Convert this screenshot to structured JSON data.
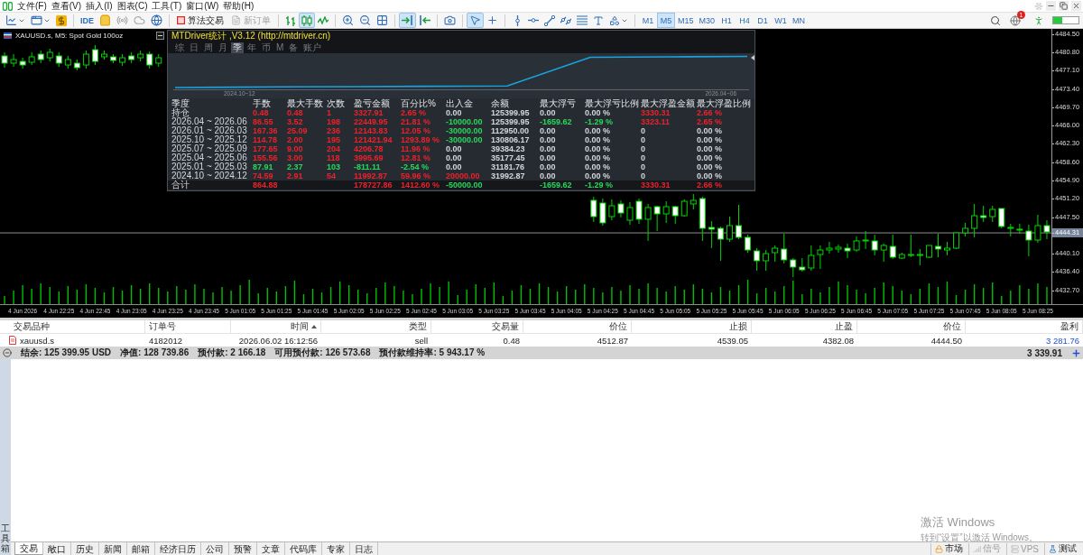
{
  "menu_bar": {
    "items": [
      "文件(F)",
      "查看(V)",
      "插入(I)",
      "图表(C)",
      "工具(T)",
      "窗口(W)",
      "帮助(H)"
    ]
  },
  "toolbar": {
    "ide_label": "IDE",
    "algo_trading": {
      "label": "算法交易",
      "on": false
    },
    "new_order": {
      "label": "新订单",
      "disabled": true
    },
    "chart_modes": [
      {
        "selected": false
      },
      {
        "selected": true
      },
      {
        "selected": false
      }
    ],
    "auto_scroll": {
      "on": true
    },
    "chart_shift": {
      "on": false
    },
    "cursor_modes": [
      {
        "selected": true
      },
      {
        "selected": false
      }
    ],
    "timeframes": [
      {
        "label": "M1",
        "selected": false
      },
      {
        "label": "M5",
        "selected": true
      },
      {
        "label": "M15",
        "selected": false
      },
      {
        "label": "M30",
        "selected": false
      },
      {
        "label": "H1",
        "selected": false
      },
      {
        "label": "H4",
        "selected": false
      },
      {
        "label": "D1",
        "selected": false
      },
      {
        "label": "W1",
        "selected": false
      },
      {
        "label": "MN",
        "selected": false
      }
    ],
    "notification_badge": "1"
  },
  "chart": {
    "title": "XAUUSD.s, M5: Spot Gold 100oz",
    "chart_data": {
      "type": "candlestick",
      "categories": [
        null,
        null,
        "4 Jun 2026",
        null,
        null,
        null,
        "4 Jun 22:25",
        null,
        null,
        null,
        "4 Jun 22:45",
        null,
        null,
        null,
        "4 Jun 23:05",
        null,
        null,
        null,
        "4 Jun 23:25",
        null,
        null,
        null,
        "4 Jun 23:45",
        null,
        null,
        null,
        "5 Jun 01:05",
        null,
        null,
        null,
        "5 Jun 01:25",
        null,
        null,
        null,
        "5 Jun 01:45",
        null,
        null,
        null,
        "5 Jun 02:05",
        null,
        null,
        null,
        "5 Jun 02:25",
        null,
        null,
        null,
        "5 Jun 02:45",
        null,
        null,
        null,
        "5 Jun 03:05",
        null,
        null,
        null,
        "5 Jun 03:25",
        null,
        null,
        null,
        "5 Jun 03:45",
        null,
        null,
        null,
        "5 Jun 04:05",
        null,
        null,
        null,
        "5 Jun 04:25",
        null,
        null,
        null,
        "5 Jun 04:45",
        null,
        null,
        null,
        "5 Jun 05:05",
        null,
        null,
        null,
        "5 Jun 05:25",
        null,
        null,
        null,
        "5 Jun 05:45",
        null,
        null,
        null,
        "5 Jun 06:05",
        null,
        null,
        null,
        "5 Jun 06:25",
        null,
        null,
        null,
        "5 Jun 06:45",
        null,
        null,
        null,
        "5 Jun 07:05",
        null,
        null,
        null,
        "5 Jun 07:25",
        null,
        null,
        null,
        "5 Jun 07:45",
        null,
        null,
        null,
        "5 Jun 08:05",
        null,
        null,
        null,
        "5 Jun 08:25",
        null
      ],
      "ohlc": [
        [
          4480.07,
          4480.8,
          4477.7,
          4478.61
        ],
        [
          4478.61,
          4480.43,
          4477.88,
          4479.34
        ],
        [
          4478.97,
          4479.7,
          4477.51,
          4478.24
        ],
        [
          4478.79,
          4480.8,
          4478.24,
          4479.89
        ],
        [
          4480.43,
          4481.16,
          4478.61,
          4479.34
        ],
        [
          4479.7,
          4481.53,
          4478.97,
          4480.8
        ],
        [
          4480.07,
          4480.8,
          4477.88,
          4478.61
        ],
        [
          4478.24,
          4480.07,
          4477.51,
          4479.34
        ],
        [
          4478.61,
          4479.34,
          4477.15,
          4477.7
        ],
        [
          4478.24,
          4481.16,
          4477.51,
          4480.43
        ],
        [
          4481.34,
          4482.26,
          4478.24,
          4478.97
        ],
        [
          4479.89,
          4481.16,
          4479.34,
          4480.43
        ],
        [
          4479.89,
          4480.43,
          4478.61,
          4479.16
        ],
        [
          4478.79,
          4480.43,
          4478.06,
          4479.7
        ],
        [
          4480.07,
          4480.8,
          4478.61,
          4479.34
        ],
        [
          4479.7,
          4481.16,
          4478.97,
          4480.43
        ],
        [
          4480.43,
          4480.98,
          4477.51,
          4478.24
        ],
        [
          4478.61,
          4480.43,
          4477.88,
          4479.7
        ],
        null,
        null,
        null,
        null,
        null,
        null,
        null,
        null,
        null,
        null,
        null,
        null,
        null,
        null,
        null,
        null,
        null,
        null,
        null,
        null,
        null,
        null,
        null,
        null,
        null,
        null,
        null,
        null,
        null,
        null,
        null,
        null,
        null,
        null,
        null,
        null,
        null,
        null,
        null,
        null,
        null,
        null,
        null,
        null,
        null,
        null,
        null,
        [
          4450.89,
          4451.61,
          4446.51,
          4447.6
        ],
        [
          4450.34,
          4451.25,
          4445.78,
          4446.33
        ],
        [
          4447.6,
          4451.07,
          4446.87,
          4449.79
        ],
        [
          4450.16,
          4450.89,
          4447.42,
          4448.33
        ],
        [
          4446.87,
          4450.52,
          4445.96,
          4449.43
        ],
        [
          4450.7,
          4451.25,
          4446.14,
          4447.06
        ],
        [
          4447.06,
          4450.16,
          4442.68,
          4449.43
        ],
        [
          4449.61,
          4449.79,
          4444.68,
          4448.15
        ],
        [
          4448.15,
          4450.7,
          4446.33,
          4449.61
        ],
        [
          4449.61,
          4449.79,
          4446.14,
          4447.78
        ],
        [
          4447.78,
          4451.07,
          4447.6,
          4450.7
        ],
        [
          4450.16,
          4452.16,
          4449.06,
          4450.89
        ],
        [
          4451.25,
          4451.61,
          4442.68,
          4445.23
        ],
        [
          4445.41,
          4446.69,
          4441.22,
          4445.05
        ],
        [
          4445.23,
          4445.6,
          4438.67,
          4443.04
        ],
        [
          4443.04,
          4447.6,
          4442.5,
          4445.78
        ],
        [
          4445.78,
          4449.97,
          4443.04,
          4443.41
        ],
        [
          4443.41,
          4443.95,
          4440.31,
          4440.85
        ],
        [
          4440.67,
          4441.22,
          4436.66,
          4438.67
        ],
        [
          4438.67,
          4440.85,
          4436.66,
          4440.12
        ],
        [
          4440.31,
          4441.77,
          4438.48,
          4441.22
        ],
        [
          4441.04,
          4444.14,
          4438.12,
          4438.85
        ],
        [
          4438.85,
          4439.21,
          4435.38,
          4437.39
        ],
        [
          4437.39,
          4439.21,
          4436.48,
          4436.84
        ],
        [
          4437.21,
          4441.77,
          4436.66,
          4439.76
        ],
        [
          4439.94,
          4441.77,
          4437.02,
          4440.85
        ],
        [
          4440.85,
          4442.5,
          4440.12,
          4441.22
        ],
        [
          4441.04,
          4441.95,
          4440.31,
          4441.4
        ],
        [
          4441.22,
          4442.13,
          4439.21,
          4440.67
        ],
        [
          4440.85,
          4443.59,
          4440.49,
          4442.68
        ],
        [
          4442.68,
          4444.68,
          4441.04,
          4442.86
        ],
        [
          4442.68,
          4443.95,
          4439.76,
          4440.85
        ],
        [
          4440.85,
          4442.13,
          4438.48,
          4441.77
        ],
        [
          4441.58,
          4443.95,
          4439.03,
          4439.39
        ],
        [
          4439.21,
          4440.31,
          4439.03,
          4439.94
        ],
        [
          4439.76,
          4443.95,
          4439.39,
          4439.94
        ],
        [
          4439.76,
          4441.04,
          4437.75,
          4439.94
        ],
        [
          4439.39,
          4441.77,
          4439.21,
          4441.77
        ],
        [
          4441.58,
          4444.14,
          4439.39,
          4441.04
        ],
        [
          4440.85,
          4442.5,
          4439.76,
          4441.22
        ],
        [
          4441.22,
          4444.32,
          4441.04,
          4444.32
        ],
        [
          4444.32,
          4446.33,
          4443.59,
          4445.23
        ],
        [
          4445.23,
          4450.16,
          4443.41,
          4447.78
        ],
        [
          4447.78,
          4449.79,
          4446.51,
          4447.42
        ],
        [
          4447.6,
          4449.79,
          4446.51,
          4449.06
        ],
        [
          4449.24,
          4449.24,
          4445.23,
          4445.6
        ],
        [
          4445.41,
          4446.14,
          4443.59,
          4445.23
        ],
        [
          4445.05,
          4446.14,
          4444.14,
          4444.87
        ],
        [
          4444.68,
          4445.96,
          4439.58,
          4442.86
        ],
        [
          4442.86,
          4447.97,
          4442.31,
          4445.78
        ],
        [
          4445.78,
          4446.87,
          4443.04,
          4444.5
        ]
      ],
      "ylim": [
        4429.91,
        4485.54
      ],
      "yticks": [
        {
          "value": 4484.5,
          "label": "4484.50"
        },
        {
          "value": 4480.8,
          "label": "4480.80"
        },
        {
          "value": 4477.1,
          "label": "4477.10"
        },
        {
          "value": 4473.4,
          "label": "4473.40"
        },
        {
          "value": 4469.7,
          "label": "4469.70"
        },
        {
          "value": 4466.0,
          "label": "4466.00"
        },
        {
          "value": 4462.3,
          "label": "4462.30"
        },
        {
          "value": 4458.6,
          "label": "4458.60"
        },
        {
          "value": 4454.9,
          "label": "4454.90"
        },
        {
          "value": 4451.2,
          "label": "4451.20"
        },
        {
          "value": 4447.5,
          "label": "4447.50"
        },
        {
          "value": 4440.1,
          "label": "4440.10"
        },
        {
          "value": 4436.4,
          "label": "4436.40"
        },
        {
          "value": 4432.7,
          "label": "4432.70"
        }
      ],
      "ref_lines": [
        {
          "axis": "y",
          "value": 4444.31,
          "label": "4444.31"
        }
      ]
    }
  },
  "stats_panel": {
    "title": "MTDriver统计 ,V3.12 (http://mtdriver.cn)",
    "tabs": [
      {
        "label": "综",
        "selected": false
      },
      {
        "label": "日",
        "selected": false
      },
      {
        "label": "周",
        "selected": false
      },
      {
        "label": "月",
        "selected": false
      },
      {
        "label": "季",
        "selected": true
      },
      {
        "label": "年",
        "selected": false
      },
      {
        "label": "币",
        "selected": false
      },
      {
        "label": "M",
        "selected": false
      },
      {
        "label": "备",
        "selected": false
      },
      {
        "label": "账户",
        "selected": false
      }
    ],
    "equity_dates": [
      "2024.10~12",
      "2026.04~06"
    ],
    "columns": [
      "季度",
      "手数",
      "最大手数",
      "次数",
      "盈亏金额",
      "百分比%",
      "出入金",
      "余额",
      "最大浮亏",
      "最大浮亏比例",
      "最大浮盈金额",
      "最大浮盈比例"
    ],
    "rows": [
      {
        "period": "持仓",
        "lots": {
          "value": "0.48",
          "color": "#e8232b"
        },
        "max_lots": {
          "value": "0.48",
          "color": "#e8232b"
        },
        "trades": {
          "value": "1",
          "color": "#e8232b"
        },
        "profit": {
          "value": "3327.91",
          "color": "#e8232b"
        },
        "percent": {
          "value": "2.65 %",
          "color": "#e8232b"
        },
        "deposit": {
          "value": "0.00"
        },
        "balance": {
          "value": "125399.95"
        },
        "max_loss": {
          "value": "0.00"
        },
        "max_loss_pct": {
          "value": "0.00 %"
        },
        "max_gain": {
          "value": "3330.31",
          "color": "#e8232b"
        },
        "max_gain_pct": {
          "value": "2.66 %",
          "color": "#e8232b"
        }
      },
      {
        "period": "2026.04 ~ 2026.06",
        "lots": {
          "value": "86.55",
          "color": "#e8232b"
        },
        "max_lots": {
          "value": "3.52",
          "color": "#e8232b"
        },
        "trades": {
          "value": "198",
          "color": "#e8232b"
        },
        "profit": {
          "value": "22449.95",
          "color": "#e8232b"
        },
        "percent": {
          "value": "21.81 %",
          "color": "#e8232b"
        },
        "deposit": {
          "value": "-10000.00",
          "color": "#2bd65c"
        },
        "balance": {
          "value": "125399.95"
        },
        "max_loss": {
          "value": "-1659.62",
          "color": "#2bd65c"
        },
        "max_loss_pct": {
          "value": "-1.29 %",
          "color": "#2bd65c"
        },
        "max_gain": {
          "value": "3323.11",
          "color": "#e8232b"
        },
        "max_gain_pct": {
          "value": "2.65 %",
          "color": "#e8232b"
        }
      },
      {
        "period": "2026.01 ~ 2026.03",
        "lots": {
          "value": "167.36",
          "color": "#e8232b"
        },
        "max_lots": {
          "value": "25.09",
          "color": "#e8232b"
        },
        "trades": {
          "value": "236",
          "color": "#e8232b"
        },
        "profit": {
          "value": "12143.83",
          "color": "#e8232b"
        },
        "percent": {
          "value": "12.05 %",
          "color": "#e8232b"
        },
        "deposit": {
          "value": "-30000.00",
          "color": "#2bd65c"
        },
        "balance": {
          "value": "112950.00"
        },
        "max_loss": {
          "value": "0.00"
        },
        "max_loss_pct": {
          "value": "0.00 %"
        },
        "max_gain": {
          "value": "0"
        },
        "max_gain_pct": {
          "value": "0.00 %"
        }
      },
      {
        "period": "2025.10 ~ 2025.12",
        "lots": {
          "value": "114.78",
          "color": "#e8232b"
        },
        "max_lots": {
          "value": "2.00",
          "color": "#e8232b"
        },
        "trades": {
          "value": "195",
          "color": "#e8232b"
        },
        "profit": {
          "value": "121421.94",
          "color": "#e8232b"
        },
        "percent": {
          "value": "1293.89 %",
          "color": "#e8232b"
        },
        "deposit": {
          "value": "-30000.00",
          "color": "#2bd65c"
        },
        "balance": {
          "value": "130806.17"
        },
        "max_loss": {
          "value": "0.00"
        },
        "max_loss_pct": {
          "value": "0.00 %"
        },
        "max_gain": {
          "value": "0"
        },
        "max_gain_pct": {
          "value": "0.00 %"
        }
      },
      {
        "period": "2025.07 ~ 2025.09",
        "lots": {
          "value": "177.65",
          "color": "#e8232b"
        },
        "max_lots": {
          "value": "9.00",
          "color": "#e8232b"
        },
        "trades": {
          "value": "204",
          "color": "#e8232b"
        },
        "profit": {
          "value": "4206.78",
          "color": "#e8232b"
        },
        "percent": {
          "value": "11.96 %",
          "color": "#e8232b"
        },
        "deposit": {
          "value": "0.00"
        },
        "balance": {
          "value": "39384.23"
        },
        "max_loss": {
          "value": "0.00"
        },
        "max_loss_pct": {
          "value": "0.00 %"
        },
        "max_gain": {
          "value": "0"
        },
        "max_gain_pct": {
          "value": "0.00 %"
        }
      },
      {
        "period": "2025.04 ~ 2025.06",
        "lots": {
          "value": "155.56",
          "color": "#e8232b"
        },
        "max_lots": {
          "value": "3.00",
          "color": "#e8232b"
        },
        "trades": {
          "value": "118",
          "color": "#e8232b"
        },
        "profit": {
          "value": "3995.69",
          "color": "#e8232b"
        },
        "percent": {
          "value": "12.81 %",
          "color": "#e8232b"
        },
        "deposit": {
          "value": "0.00"
        },
        "balance": {
          "value": "35177.45"
        },
        "max_loss": {
          "value": "0.00"
        },
        "max_loss_pct": {
          "value": "0.00 %"
        },
        "max_gain": {
          "value": "0"
        },
        "max_gain_pct": {
          "value": "0.00 %"
        }
      },
      {
        "period": "2025.01 ~ 2025.03",
        "lots": {
          "value": "87.91",
          "color": "#2bd65c"
        },
        "max_lots": {
          "value": "2.37",
          "color": "#2bd65c"
        },
        "trades": {
          "value": "103",
          "color": "#2bd65c"
        },
        "profit": {
          "value": "-811.11",
          "color": "#2bd65c"
        },
        "percent": {
          "value": "-2.54 %",
          "color": "#2bd65c"
        },
        "deposit": {
          "value": "0.00"
        },
        "balance": {
          "value": "31181.76"
        },
        "max_loss": {
          "value": "0.00"
        },
        "max_loss_pct": {
          "value": "0.00 %"
        },
        "max_gain": {
          "value": "0"
        },
        "max_gain_pct": {
          "value": "0.00 %"
        }
      },
      {
        "period": "2024.10 ~ 2024.12",
        "lots": {
          "value": "74.59",
          "color": "#e8232b"
        },
        "max_lots": {
          "value": "2.91",
          "color": "#e8232b"
        },
        "trades": {
          "value": "54",
          "color": "#e8232b"
        },
        "profit": {
          "value": "11992.87",
          "color": "#e8232b"
        },
        "percent": {
          "value": "59.96 %",
          "color": "#e8232b"
        },
        "deposit": {
          "value": "20000.00",
          "color": "#e8232b"
        },
        "balance": {
          "value": "31992.87"
        },
        "max_loss": {
          "value": "0.00"
        },
        "max_loss_pct": {
          "value": "0.00 %"
        },
        "max_gain": {
          "value": "0"
        },
        "max_gain_pct": {
          "value": "0.00 %"
        }
      }
    ],
    "total": {
      "period": "合计",
      "lots": {
        "value": "864.88",
        "color": "#e8232b"
      },
      "profit": {
        "value": "178727.86",
        "color": "#e8232b"
      },
      "percent": {
        "value": "1412.60 %",
        "color": "#e8232b"
      },
      "deposit": {
        "value": "-50000.00",
        "color": "#2bd65c"
      },
      "max_loss": {
        "value": "-1659.62",
        "color": "#2bd65c"
      },
      "max_loss_pct": {
        "value": "-1.29 %",
        "color": "#2bd65c"
      },
      "max_gain": {
        "value": "3330.31",
        "color": "#e8232b"
      },
      "max_gain_pct": {
        "value": "2.66 %",
        "color": "#e8232b"
      }
    }
  },
  "terminal": {
    "columns": [
      {
        "label": "交易品种",
        "sorted": false
      },
      {
        "label": "订单号",
        "sorted": false
      },
      {
        "label": "时间",
        "sorted": true
      },
      {
        "label": "类型",
        "sorted": false
      },
      {
        "label": "交易量",
        "sorted": false
      },
      {
        "label": "价位",
        "sorted": false
      },
      {
        "label": "止损",
        "sorted": false
      },
      {
        "label": "止盈",
        "sorted": false
      },
      {
        "label": "价位",
        "sorted": false
      },
      {
        "label": "盈利",
        "sorted": false
      }
    ],
    "rows": [
      {
        "symbol": "xauusd.s",
        "order": "4182012",
        "time": "2026.06.02 16:12:56",
        "type": "sell",
        "volume": "0.48",
        "open_price": "4512.87",
        "stop_loss": "4539.05",
        "take_profit": "4382.08",
        "price": "4444.50",
        "profit": "3 281.76"
      }
    ],
    "summary": {
      "items": [
        "结余: 125 399.95 USD",
        "净值: 128 739.86",
        "预付款: 2 166.18",
        "可用预付款: 126 573.68",
        "预付款维持率: 5 943.17 %"
      ],
      "profit": "3 339.91"
    }
  },
  "toolbox_label": "工具箱",
  "bottom_tabs": [
    {
      "label": "交易",
      "selected": true
    },
    {
      "label": "敞口",
      "selected": false
    },
    {
      "label": "历史",
      "selected": false
    },
    {
      "label": "新闻",
      "selected": false
    },
    {
      "label": "邮箱",
      "selected": false
    },
    {
      "label": "经济日历",
      "selected": false
    },
    {
      "label": "公司",
      "selected": false
    },
    {
      "label": "预警",
      "selected": false
    },
    {
      "label": "文章",
      "selected": false
    },
    {
      "label": "代码库",
      "selected": false
    },
    {
      "label": "专家",
      "selected": false
    },
    {
      "label": "日志",
      "selected": false
    }
  ],
  "status_items": [
    {
      "label": "市场",
      "disabled": false
    },
    {
      "label": "信号",
      "disabled": true
    },
    {
      "label": "VPS",
      "disabled": true
    },
    {
      "label": "测试",
      "disabled": false
    }
  ],
  "windows_notice": {
    "title": "激活 Windows",
    "text": "转到“设置”以激活 Windows。"
  }
}
